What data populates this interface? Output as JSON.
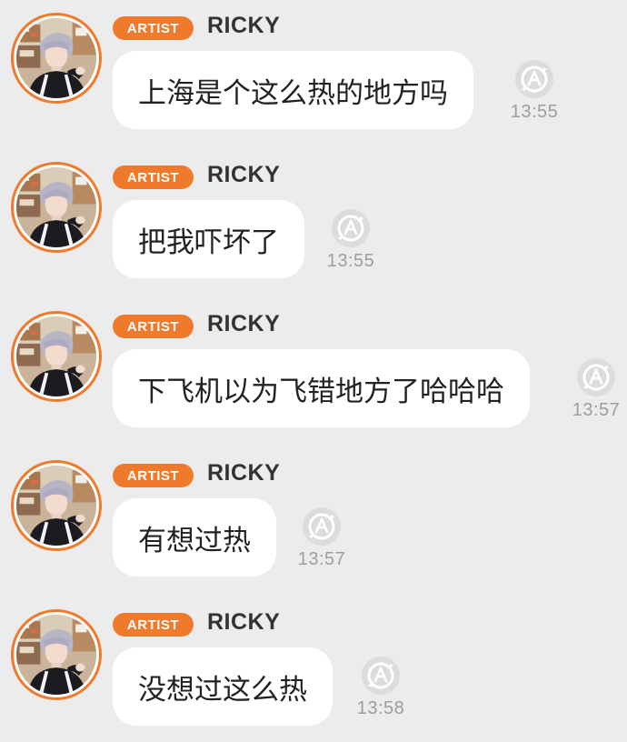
{
  "chat": {
    "messages": [
      {
        "badge": "ARTIST",
        "sender": "RICKY",
        "text": "上海是个这么热的地方吗",
        "time": "13:55"
      },
      {
        "badge": "ARTIST",
        "sender": "RICKY",
        "text": "把我吓坏了",
        "time": "13:55"
      },
      {
        "badge": "ARTIST",
        "sender": "RICKY",
        "text": "下飞机以为飞错地方了哈哈哈",
        "time": "13:57"
      },
      {
        "badge": "ARTIST",
        "sender": "RICKY",
        "text": "有想过热",
        "time": "13:57"
      },
      {
        "badge": "ARTIST",
        "sender": "RICKY",
        "text": "没想过这么热",
        "time": "13:58"
      }
    ]
  },
  "colors": {
    "background": "#ececec",
    "badge": "#f07a2c",
    "bubble": "#ffffff",
    "text": "#222222",
    "time": "#9d9d9d"
  },
  "icons": {
    "translate": "translate-icon"
  }
}
